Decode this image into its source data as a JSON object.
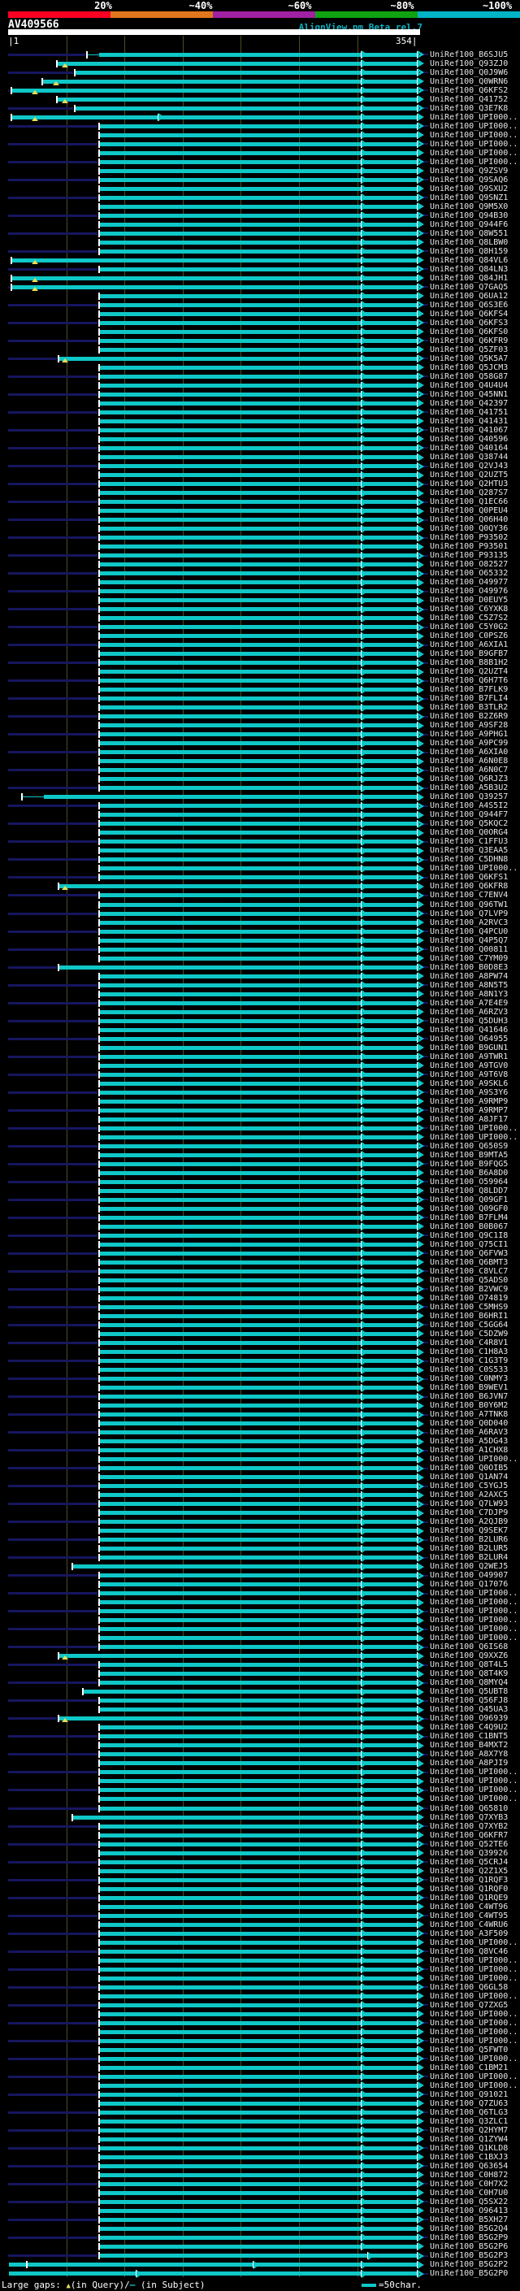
{
  "header": {
    "scale_labels": [
      "20%",
      "~40%",
      "~60%",
      "~80%",
      "~100%"
    ],
    "scale_colors": [
      "#fb0022",
      "#e0771c",
      "#a220a2",
      "#0fa312",
      "#00b4c6"
    ],
    "query_id": "AV409566",
    "app_title": "AlignView.pm Beta rel.7",
    "ruler_start_label": "|1",
    "ruler_end_label": "354|"
  },
  "plot": {
    "query_length": 354,
    "gridlines": [
      50,
      100,
      150,
      200,
      250,
      300
    ],
    "row_default": {
      "start": 78,
      "end": 352,
      "arrows": [
        304,
        352
      ]
    },
    "rows": [
      {
        "id": "UniRef100_B6SJU5",
        "start": 68,
        "gapline_to": 78
      },
      {
        "id": "UniRef100_Q93ZJ0",
        "start": 42,
        "tris": [
          49
        ]
      },
      {
        "id": "UniRef100_Q0J9W6",
        "start": 57
      },
      {
        "id": "UniRef100_Q0WRN6",
        "start": 29,
        "tris": [
          41
        ]
      },
      {
        "id": "UniRef100_Q6KFS2",
        "start": 3,
        "tris": [
          23
        ]
      },
      {
        "id": "UniRef100_Q41752",
        "start": 42,
        "tris": [
          49
        ]
      },
      {
        "id": "UniRef100_Q3E7K8",
        "start": 57
      },
      {
        "id": "UniRef100_UPI000..",
        "start": 3,
        "tris": [
          23
        ],
        "arrows": [
          129,
          304,
          352
        ]
      },
      {
        "id": "UniRef100_UPI000.."
      },
      {
        "id": "UniRef100_UPI000.."
      },
      {
        "id": "UniRef100_UPI000.."
      },
      {
        "id": "UniRef100_UPI000.."
      },
      {
        "id": "UniRef100_UPI000.."
      },
      {
        "id": "UniRef100_Q9ZSV9"
      },
      {
        "id": "UniRef100_Q9SAQ6"
      },
      {
        "id": "UniRef100_Q9SXU2"
      },
      {
        "id": "UniRef100_Q9SNZ1"
      },
      {
        "id": "UniRef100_Q9M5X0"
      },
      {
        "id": "UniRef100_Q94B30"
      },
      {
        "id": "UniRef100_Q944F6"
      },
      {
        "id": "UniRef100_Q8W551"
      },
      {
        "id": "UniRef100_Q8LBW0"
      },
      {
        "id": "UniRef100_Q8H159"
      },
      {
        "id": "UniRef100_Q84VL6",
        "start": 3,
        "tris": [
          23
        ]
      },
      {
        "id": "UniRef100_Q84LN3"
      },
      {
        "id": "UniRef100_Q84JH1",
        "start": 3,
        "tris": [
          23
        ]
      },
      {
        "id": "UniRef100_Q7GAQ5",
        "start": 3,
        "tris": [
          23
        ]
      },
      {
        "id": "UniRef100_Q6UA12"
      },
      {
        "id": "UniRef100_Q6S3E6"
      },
      {
        "id": "UniRef100_Q6KFS4"
      },
      {
        "id": "UniRef100_Q6KFS3"
      },
      {
        "id": "UniRef100_Q6KFS0"
      },
      {
        "id": "UniRef100_Q6KFR9"
      },
      {
        "id": "UniRef100_Q5ZF03"
      },
      {
        "id": "UniRef100_Q5K5A7",
        "start": 43,
        "tris": [
          49
        ]
      },
      {
        "id": "UniRef100_Q5JCM3"
      },
      {
        "id": "UniRef100_Q58G87"
      },
      {
        "id": "UniRef100_Q4U4U4"
      },
      {
        "id": "UniRef100_Q45NN1"
      },
      {
        "id": "UniRef100_Q42397"
      },
      {
        "id": "UniRef100_Q41751"
      },
      {
        "id": "UniRef100_Q41431"
      },
      {
        "id": "UniRef100_Q41067"
      },
      {
        "id": "UniRef100_Q40596"
      },
      {
        "id": "UniRef100_Q40164"
      },
      {
        "id": "UniRef100_Q38744"
      },
      {
        "id": "UniRef100_Q2VJ43"
      },
      {
        "id": "UniRef100_Q2UZT5"
      },
      {
        "id": "UniRef100_Q2HTU3"
      },
      {
        "id": "UniRef100_Q287S7"
      },
      {
        "id": "UniRef100_Q1EC66"
      },
      {
        "id": "UniRef100_Q0PEU4"
      },
      {
        "id": "UniRef100_Q06H40"
      },
      {
        "id": "UniRef100_Q0QY36"
      },
      {
        "id": "UniRef100_P93502"
      },
      {
        "id": "UniRef100_P93501"
      },
      {
        "id": "UniRef100_P93135"
      },
      {
        "id": "UniRef100_O82527"
      },
      {
        "id": "UniRef100_O65332"
      },
      {
        "id": "UniRef100_O49977"
      },
      {
        "id": "UniRef100_O49976"
      },
      {
        "id": "UniRef100_D0EUY5"
      },
      {
        "id": "UniRef100_C6YXK8"
      },
      {
        "id": "UniRef100_C5Z7S2"
      },
      {
        "id": "UniRef100_C5Y0G2"
      },
      {
        "id": "UniRef100_C0PSZ6"
      },
      {
        "id": "UniRef100_A6XIA1"
      },
      {
        "id": "UniRef100_B9GFB7"
      },
      {
        "id": "UniRef100_B8B1H2"
      },
      {
        "id": "UniRef100_Q2UZT4"
      },
      {
        "id": "UniRef100_Q6H7T6"
      },
      {
        "id": "UniRef100_B7FLK9"
      },
      {
        "id": "UniRef100_B7FLI4"
      },
      {
        "id": "UniRef100_B3TLR2"
      },
      {
        "id": "UniRef100_B2Z6R9"
      },
      {
        "id": "UniRef100_A9SF28"
      },
      {
        "id": "UniRef100_A9PHG1"
      },
      {
        "id": "UniRef100_A9PC99"
      },
      {
        "id": "UniRef100_A6XIA0"
      },
      {
        "id": "UniRef100_A6N0E8"
      },
      {
        "id": "UniRef100_A6N0C7"
      },
      {
        "id": "UniRef100_Q6RJZ3"
      },
      {
        "id": "UniRef100_A5B3U2"
      },
      {
        "id": "UniRef100_Q39257",
        "start": 12,
        "gapline_to": 31
      },
      {
        "id": "UniRef100_A4S5I2"
      },
      {
        "id": "UniRef100_Q944F7"
      },
      {
        "id": "UniRef100_Q5KQC2"
      },
      {
        "id": "UniRef100_Q0ORG4"
      },
      {
        "id": "UniRef100_C1FFU3"
      },
      {
        "id": "UniRef100_Q3EAA5"
      },
      {
        "id": "UniRef100_C5DHN8"
      },
      {
        "id": "UniRef100_UPI000.."
      },
      {
        "id": "UniRef100_Q6KFS1"
      },
      {
        "id": "UniRef100_Q6KFR8",
        "start": 43,
        "tris": [
          49
        ]
      },
      {
        "id": "UniRef100_C7ENV4"
      },
      {
        "id": "UniRef100_Q96TW1"
      },
      {
        "id": "UniRef100_Q7LVP9"
      },
      {
        "id": "UniRef100_A2RVC3"
      },
      {
        "id": "UniRef100_Q4PCU0"
      },
      {
        "id": "UniRef100_Q4P5Q7"
      },
      {
        "id": "UniRef100_Q00811"
      },
      {
        "id": "UniRef100_C7YM09"
      },
      {
        "id": "UniRef100_B0D8E3",
        "start": 43
      },
      {
        "id": "UniRef100_A8PW74"
      },
      {
        "id": "UniRef100_A8N5T5"
      },
      {
        "id": "UniRef100_A8N1Y3"
      },
      {
        "id": "UniRef100_A7E4E9"
      },
      {
        "id": "UniRef100_A6RZV3"
      },
      {
        "id": "UniRef100_Q5DUH3"
      },
      {
        "id": "UniRef100_Q41646"
      },
      {
        "id": "UniRef100_O64955"
      },
      {
        "id": "UniRef100_B9GUN1"
      },
      {
        "id": "UniRef100_A9TWR1"
      },
      {
        "id": "UniRef100_A9TGV0"
      },
      {
        "id": "UniRef100_A9T6V8"
      },
      {
        "id": "UniRef100_A9SKL6"
      },
      {
        "id": "UniRef100_A9S3Y6"
      },
      {
        "id": "UniRef100_A9RMP9"
      },
      {
        "id": "UniRef100_A9RMP7"
      },
      {
        "id": "UniRef100_A8JF17"
      },
      {
        "id": "UniRef100_UPI000.."
      },
      {
        "id": "UniRef100_UPI000.."
      },
      {
        "id": "UniRef100_Q650S9"
      },
      {
        "id": "UniRef100_B9MTA5"
      },
      {
        "id": "UniRef100_B9FQG5"
      },
      {
        "id": "UniRef100_B6A8D0"
      },
      {
        "id": "UniRef100_O59964"
      },
      {
        "id": "UniRef100_Q8LDD7"
      },
      {
        "id": "UniRef100_Q09GF1"
      },
      {
        "id": "UniRef100_Q09GF0"
      },
      {
        "id": "UniRef100_B7FLM4"
      },
      {
        "id": "UniRef100_B0B067"
      },
      {
        "id": "UniRef100_Q9C1I8"
      },
      {
        "id": "UniRef100_Q75CI1"
      },
      {
        "id": "UniRef100_Q6FVW3"
      },
      {
        "id": "UniRef100_Q6BMT3"
      },
      {
        "id": "UniRef100_C8VLC7"
      },
      {
        "id": "UniRef100_Q5ADS0"
      },
      {
        "id": "UniRef100_B2VWC9"
      },
      {
        "id": "UniRef100_O74819"
      },
      {
        "id": "UniRef100_C5MHS9"
      },
      {
        "id": "UniRef100_B6HRI1"
      },
      {
        "id": "UniRef100_C5GG64"
      },
      {
        "id": "UniRef100_C5DZW9"
      },
      {
        "id": "UniRef100_C4R8V1"
      },
      {
        "id": "UniRef100_C1H8A3"
      },
      {
        "id": "UniRef100_C1G3T9"
      },
      {
        "id": "UniRef100_C0S533"
      },
      {
        "id": "UniRef100_C0NMY3"
      },
      {
        "id": "UniRef100_B9WEV1"
      },
      {
        "id": "UniRef100_B6JVN7"
      },
      {
        "id": "UniRef100_B0Y6M2"
      },
      {
        "id": "UniRef100_A7TNK8"
      },
      {
        "id": "UniRef100_Q0D040"
      },
      {
        "id": "UniRef100_A6RAV3"
      },
      {
        "id": "UniRef100_A5DG43"
      },
      {
        "id": "UniRef100_A1CHX8"
      },
      {
        "id": "UniRef100_UPI000.."
      },
      {
        "id": "UniRef100_Q0OIB5"
      },
      {
        "id": "UniRef100_Q1AN74"
      },
      {
        "id": "UniRef100_C5YGJ5"
      },
      {
        "id": "UniRef100_A2AXC5"
      },
      {
        "id": "UniRef100_Q7LW93"
      },
      {
        "id": "UniRef100_C7DJP9"
      },
      {
        "id": "UniRef100_A2QJB9"
      },
      {
        "id": "UniRef100_Q9SEK7"
      },
      {
        "id": "UniRef100_B2LUR6"
      },
      {
        "id": "UniRef100_B2LUR5"
      },
      {
        "id": "UniRef100_B2LUR4"
      },
      {
        "id": "UniRef100_Q2WEJ5",
        "start": 55
      },
      {
        "id": "UniRef100_O49907"
      },
      {
        "id": "UniRef100_Q17076"
      },
      {
        "id": "UniRef100_UPI000.."
      },
      {
        "id": "UniRef100_UPI000.."
      },
      {
        "id": "UniRef100_UPI000.."
      },
      {
        "id": "UniRef100_UPI000.."
      },
      {
        "id": "UniRef100_UPI000.."
      },
      {
        "id": "UniRef100_UPI000.."
      },
      {
        "id": "UniRef100_Q6IS68"
      },
      {
        "id": "UniRef100_Q9XXZ6",
        "start": 43,
        "tris": [
          49
        ]
      },
      {
        "id": "UniRef100_Q8T4L5"
      },
      {
        "id": "UniRef100_Q8T4K9"
      },
      {
        "id": "UniRef100_Q8MYQ4"
      },
      {
        "id": "UniRef100_Q5UBT8",
        "start": 64
      },
      {
        "id": "UniRef100_Q56FJ8"
      },
      {
        "id": "UniRef100_Q45UA3"
      },
      {
        "id": "UniRef100_O96939",
        "start": 43,
        "tris": [
          49
        ]
      },
      {
        "id": "UniRef100_C4Q9U2"
      },
      {
        "id": "UniRef100_C1BNT5"
      },
      {
        "id": "UniRef100_B4MXT2"
      },
      {
        "id": "UniRef100_A8X7Y8"
      },
      {
        "id": "UniRef100_A8PJI9"
      },
      {
        "id": "UniRef100_UPI000.."
      },
      {
        "id": "UniRef100_UPI000.."
      },
      {
        "id": "UniRef100_UPI000.."
      },
      {
        "id": "UniRef100_UPI000.."
      },
      {
        "id": "UniRef100_Q65810"
      },
      {
        "id": "UniRef100_Q7XYB3",
        "start": 55
      },
      {
        "id": "UniRef100_Q7XYB2"
      },
      {
        "id": "UniRef100_Q6KFR7"
      },
      {
        "id": "UniRef100_Q52TE6"
      },
      {
        "id": "UniRef100_Q39926"
      },
      {
        "id": "UniRef100_Q5CRJ4"
      },
      {
        "id": "UniRef100_Q2Z1X5"
      },
      {
        "id": "UniRef100_Q1RQF3"
      },
      {
        "id": "UniRef100_Q1RQF0"
      },
      {
        "id": "UniRef100_Q1RQE9"
      },
      {
        "id": "UniRef100_C4WT96"
      },
      {
        "id": "UniRef100_C4WT95"
      },
      {
        "id": "UniRef100_C4WRU6"
      },
      {
        "id": "UniRef100_A3F509"
      },
      {
        "id": "UniRef100_UPI000.."
      },
      {
        "id": "UniRef100_Q8VC46"
      },
      {
        "id": "UniRef100_UPI000.."
      },
      {
        "id": "UniRef100_UPI000.."
      },
      {
        "id": "UniRef100_UPI000.."
      },
      {
        "id": "UniRef100_Q6GL58"
      },
      {
        "id": "UniRef100_UPI000.."
      },
      {
        "id": "UniRef100_Q7ZXG5"
      },
      {
        "id": "UniRef100_UPI000.."
      },
      {
        "id": "UniRef100_UPI000.."
      },
      {
        "id": "UniRef100_UPI000.."
      },
      {
        "id": "UniRef100_UPI000.."
      },
      {
        "id": "UniRef100_Q5FWT0"
      },
      {
        "id": "UniRef100_UPI000.."
      },
      {
        "id": "UniRef100_C1BM21"
      },
      {
        "id": "UniRef100_UPI000.."
      },
      {
        "id": "UniRef100_UPI000.."
      },
      {
        "id": "UniRef100_Q91021"
      },
      {
        "id": "UniRef100_Q7ZU63"
      },
      {
        "id": "UniRef100_Q6TLG3"
      },
      {
        "id": "UniRef100_Q3ZLC1"
      },
      {
        "id": "UniRef100_Q2HYM7"
      },
      {
        "id": "UniRef100_Q1ZYW4"
      },
      {
        "id": "UniRef100_Q1KLD8"
      },
      {
        "id": "UniRef100_C1BXJ3"
      },
      {
        "id": "UniRef100_Q63654"
      },
      {
        "id": "UniRef100_C0H872"
      },
      {
        "id": "UniRef100_C0H7X2"
      },
      {
        "id": "UniRef100_C0H7U0"
      },
      {
        "id": "UniRef100_Q5SX22"
      },
      {
        "id": "UniRef100_O96413"
      },
      {
        "id": "UniRef100_B5XH27"
      },
      {
        "id": "UniRef100_B5G2Q4"
      },
      {
        "id": "UniRef100_B5G2P9"
      },
      {
        "id": "UniRef100_B5G2P6"
      },
      {
        "id": "UniRef100_B5G2P3",
        "arrows": [
          309,
          352
        ]
      },
      {
        "id": "UniRef100_B5G2P2",
        "start": 1,
        "start_tick": false,
        "ticks": [
          16
        ],
        "arrows": [
          211,
          304,
          352
        ]
      },
      {
        "id": "UniRef100_B5G2P0",
        "start": 1,
        "start_tick": false,
        "arrows": [
          110,
          304,
          352
        ]
      }
    ]
  },
  "legend": {
    "large_gaps_prefix": "Large gaps: ",
    "query_gap_symbol": "▲",
    "query_text": "(in Query)/",
    "subject_gap_symbol": "—",
    "subject_text": " (in Subject)",
    "scale_text": "=50char."
  }
}
